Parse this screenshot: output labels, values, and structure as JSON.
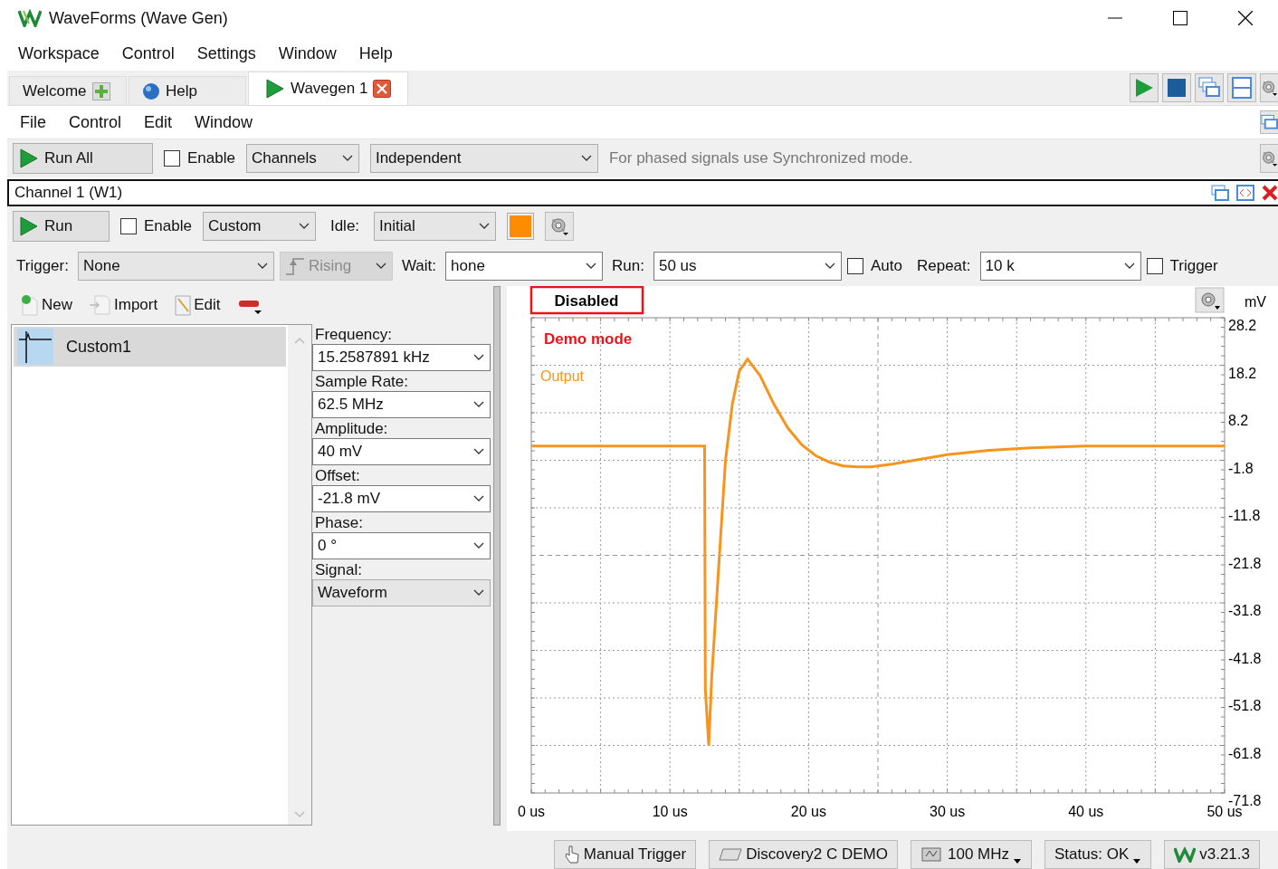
{
  "window": {
    "title": "WaveForms (Wave Gen)"
  },
  "menu": [
    "Workspace",
    "Control",
    "Settings",
    "Window",
    "Help"
  ],
  "tabs": [
    {
      "label": "Welcome",
      "kind": "welcome",
      "selected": false
    },
    {
      "label": "Help",
      "kind": "help",
      "selected": false
    },
    {
      "label": "Wavegen 1",
      "kind": "instrument",
      "selected": true
    }
  ],
  "instrument_menu": [
    "File",
    "Control",
    "Edit",
    "Window"
  ],
  "toolbar": {
    "run_all": "Run All",
    "enable": {
      "label": "Enable",
      "checked": false
    },
    "channels": "Channels",
    "mode": "Independent",
    "hint": "For phased signals use Synchronized mode."
  },
  "channel": {
    "title": "Channel 1 (W1)",
    "run": "Run",
    "enable": {
      "label": "Enable",
      "checked": false
    },
    "type": "Custom",
    "idle_label": "Idle:",
    "idle": "Initial"
  },
  "trigger_row": {
    "trigger_label": "Trigger:",
    "trigger": "None",
    "edge": {
      "label": "Rising",
      "disabled": true
    },
    "wait_label": "Wait:",
    "wait": "hone",
    "run_label": "Run:",
    "run": "50 us",
    "auto": {
      "label": "Auto",
      "checked": false
    },
    "repeat_label": "Repeat:",
    "repeat": "10 k",
    "trigger_check": {
      "label": "Trigger",
      "checked": false
    }
  },
  "library": {
    "actions": [
      {
        "label": "New",
        "kind": "new"
      },
      {
        "label": "Import",
        "kind": "import"
      },
      {
        "label": "Edit",
        "kind": "edit"
      },
      {
        "kind": "delete"
      }
    ],
    "items": [
      {
        "label": "Custom1",
        "selected": true
      }
    ]
  },
  "parameters": [
    {
      "label": "Frequency:",
      "value": "15.2587891 kHz",
      "kind": "edit"
    },
    {
      "label": "Sample Rate:",
      "value": "62.5 MHz",
      "kind": "edit"
    },
    {
      "label": "Amplitude:",
      "value": "40 mV",
      "kind": "edit"
    },
    {
      "label": "Offset:",
      "value": "-21.8 mV",
      "kind": "edit"
    },
    {
      "label": "Phase:",
      "value": "0 °",
      "kind": "edit"
    },
    {
      "label": "Signal:",
      "value": "Waveform",
      "kind": "list"
    }
  ],
  "plot": {
    "status": "Disabled",
    "chart_data": {
      "type": "line",
      "ylabel": "mV",
      "x": [
        0,
        12.5,
        12.55,
        12.8,
        13.0,
        13.5,
        14.0,
        14.5,
        15.0,
        15.6,
        16.5,
        17.5,
        18.5,
        19.5,
        20.5,
        21.5,
        22.5,
        23.5,
        24.5,
        26,
        28,
        30,
        33,
        36,
        40,
        45,
        50
      ],
      "series": [
        {
          "name": "Output",
          "color": "#f7941d",
          "values": [
            1.2,
            1.2,
            -50,
            -61.8,
            -48,
            -25,
            -2,
            10,
            17,
            19.5,
            16,
            10,
            5,
            1.5,
            -0.8,
            -2.2,
            -3,
            -3.2,
            -3.2,
            -2.6,
            -1.6,
            -0.6,
            0.3,
            0.8,
            1.2,
            1.2,
            1.2
          ]
        }
      ],
      "grid": true,
      "xlim": [
        0,
        50
      ],
      "ylim": [
        -71.8,
        28.2
      ],
      "xticks": [
        {
          "value": 0,
          "label": "0 us"
        },
        {
          "value": 10,
          "label": "10 us"
        },
        {
          "value": 20,
          "label": "20 us"
        },
        {
          "value": 30,
          "label": "30 us"
        },
        {
          "value": 40,
          "label": "40 us"
        },
        {
          "value": 50,
          "label": "50 us"
        }
      ],
      "yticks": [
        28.2,
        18.2,
        8.2,
        -1.8,
        -11.8,
        -21.8,
        -31.8,
        -41.8,
        -51.8,
        -61.8,
        -71.8
      ],
      "annotations": [
        {
          "text": "Demo mode"
        }
      ]
    }
  },
  "status_bar": [
    {
      "label": "Manual Trigger",
      "kind": "trigger",
      "menu": false
    },
    {
      "label": "Discovery2 C DEMO",
      "kind": "device",
      "menu": false
    },
    {
      "label": "100 MHz",
      "kind": "clock",
      "menu": true
    },
    {
      "label": "Status: OK",
      "kind": "status",
      "menu": true
    },
    {
      "label": "v3.21.3",
      "kind": "version",
      "menu": false
    }
  ]
}
